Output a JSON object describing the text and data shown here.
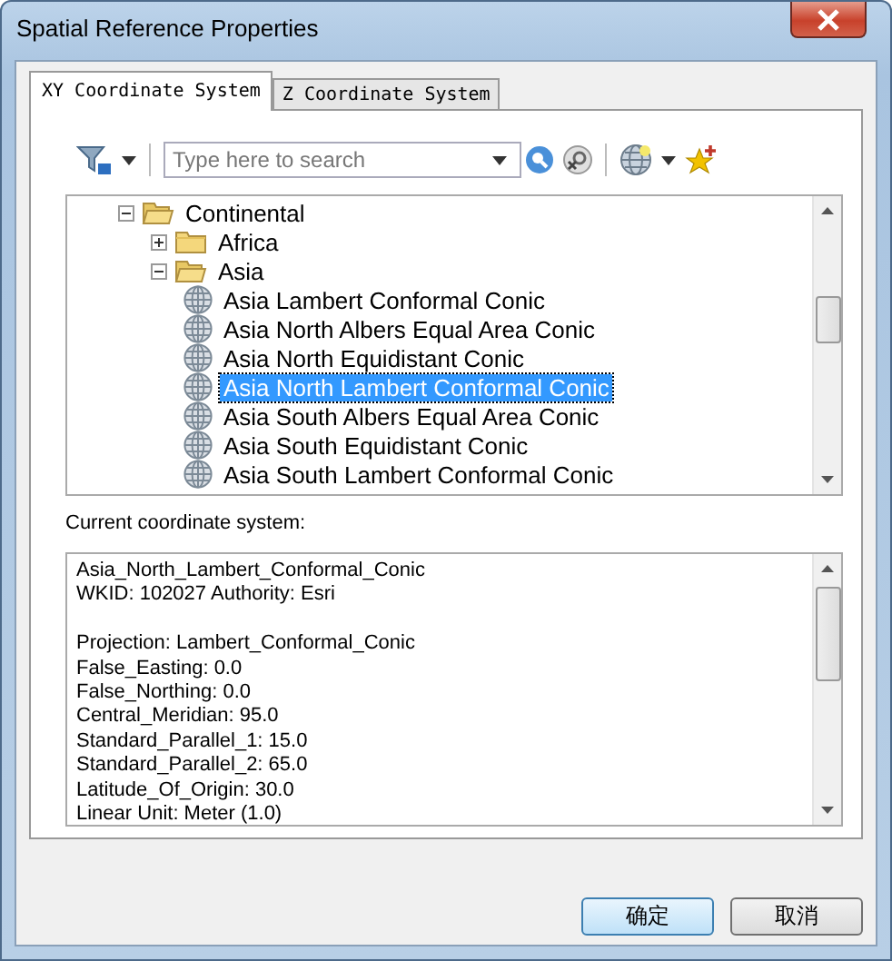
{
  "window": {
    "title": "Spatial Reference Properties"
  },
  "tabs": [
    {
      "label": "XY Coordinate System",
      "selected": true
    },
    {
      "label": "Z Coordinate System",
      "selected": false
    }
  ],
  "search": {
    "placeholder": "Type here to search"
  },
  "tree": [
    {
      "label": "Continental",
      "kind": "folder",
      "expanded": true,
      "selected": false,
      "children": [
        {
          "label": "Africa",
          "kind": "folder",
          "expanded": false,
          "selected": false
        },
        {
          "label": "Asia",
          "kind": "folder",
          "expanded": true,
          "selected": false,
          "children": [
            {
              "label": "Asia Lambert Conformal Conic",
              "kind": "crs",
              "selected": false
            },
            {
              "label": "Asia North Albers Equal Area Conic",
              "kind": "crs",
              "selected": false
            },
            {
              "label": "Asia North Equidistant Conic",
              "kind": "crs",
              "selected": false
            },
            {
              "label": "Asia North Lambert Conformal Conic",
              "kind": "crs",
              "selected": true
            },
            {
              "label": "Asia South Albers Equal Area Conic",
              "kind": "crs",
              "selected": false
            },
            {
              "label": "Asia South Equidistant Conic",
              "kind": "crs",
              "selected": false
            },
            {
              "label": "Asia South Lambert Conformal Conic",
              "kind": "crs",
              "selected": false
            }
          ]
        }
      ]
    }
  ],
  "current": {
    "label": "Current coordinate system:",
    "paragraphs": [
      [
        "Asia_North_Lambert_Conformal_Conic",
        "WKID: 102027 Authority: Esri"
      ],
      [
        "Projection: Lambert_Conformal_Conic",
        "False_Easting: 0.0",
        "False_Northing: 0.0",
        "Central_Meridian: 95.0",
        "Standard_Parallel_1: 15.0",
        "Standard_Parallel_2: 65.0",
        "Latitude_Of_Origin: 30.0",
        "Linear Unit: Meter (1.0)"
      ]
    ]
  },
  "buttons": [
    {
      "label": "确定",
      "kind": "default"
    },
    {
      "label": "取消",
      "kind": "normal"
    }
  ]
}
